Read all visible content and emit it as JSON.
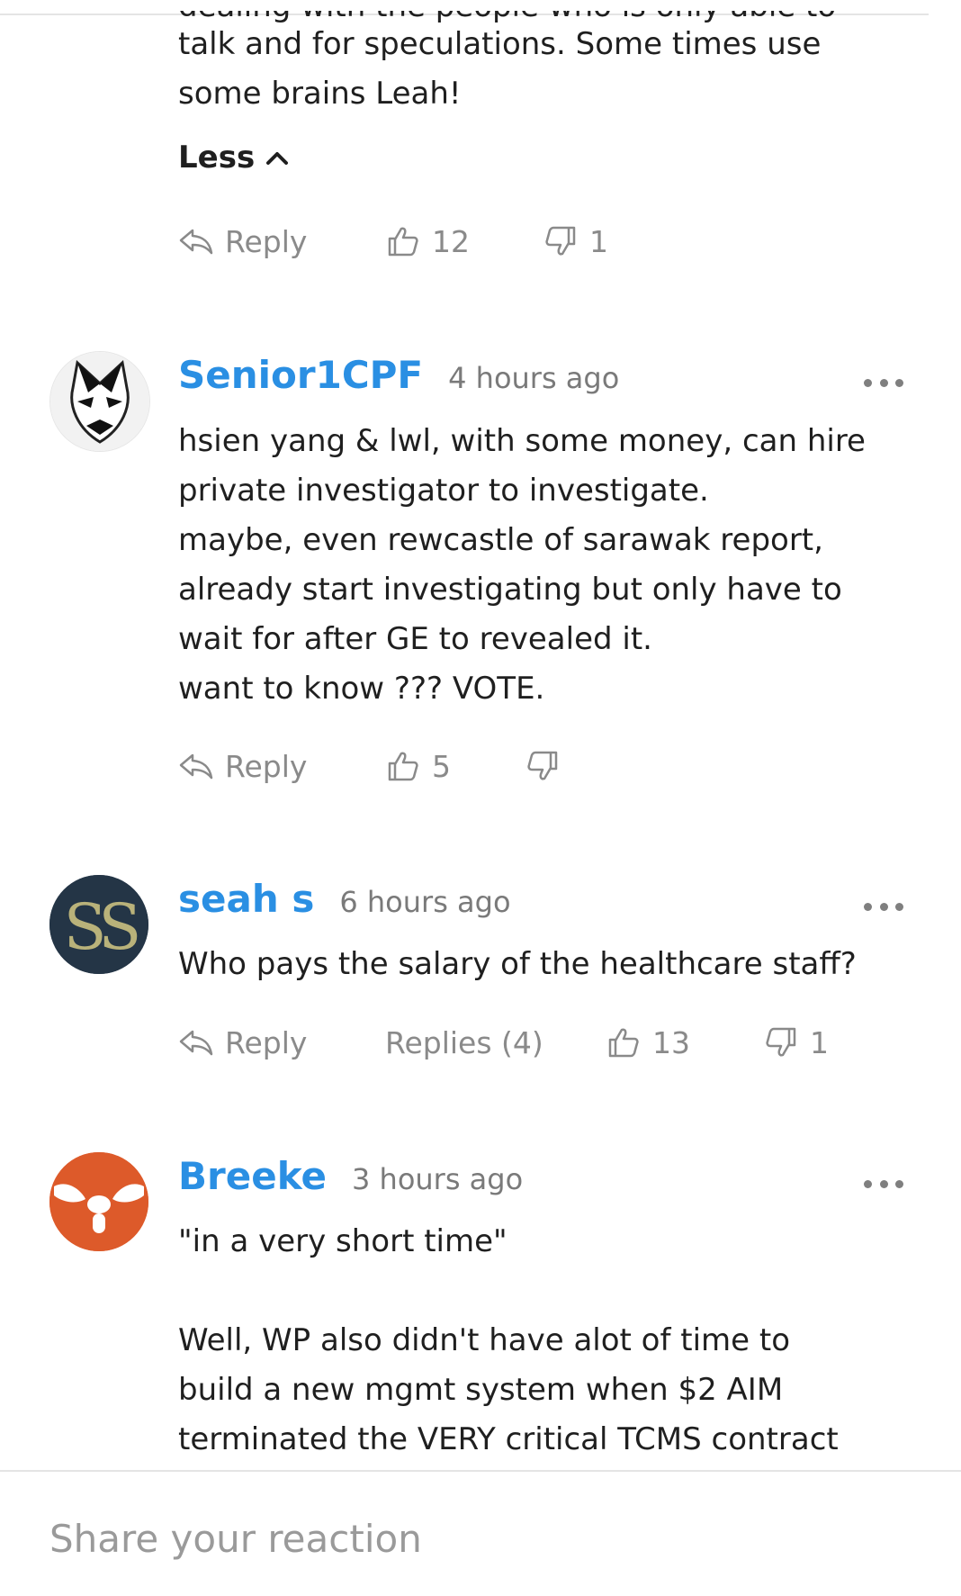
{
  "comments": [
    {
      "partial_top_line": "dealing with the people who is only able to",
      "text_lines": [
        "talk and for speculations. Some times use",
        "some brains Leah!"
      ],
      "less_label": "Less",
      "actions": {
        "reply": "Reply",
        "likes": "12",
        "dislikes": "1"
      }
    },
    {
      "username": "Senior1CPF",
      "time": "4 hours ago",
      "text_lines": [
        "hsien yang & lwl, with some money, can hire",
        "private investigator to investigate.",
        "maybe, even rewcastle of sarawak report,",
        "already start investigating but only have to",
        "wait for after GE to revealed it.",
        "want to know ??? VOTE."
      ],
      "actions": {
        "reply": "Reply",
        "likes": "5",
        "dislikes": ""
      }
    },
    {
      "username": "seah s",
      "time": "6 hours ago",
      "text_lines": [
        "Who pays the salary of the healthcare staff?"
      ],
      "actions": {
        "reply": "Reply",
        "replies": "Replies (4)",
        "likes": "13",
        "dislikes": "1"
      }
    },
    {
      "username": "Breeke",
      "time": "3 hours ago",
      "text_lines": [
        "\"in a very short time\"",
        "",
        "Well, WP also didn't have alot of time to",
        "build a new mgmt system when $2 AIM",
        "terminated the VERY critical TCMS contract"
      ]
    }
  ],
  "reaction_input": {
    "placeholder": "Share your reaction"
  },
  "colors": {
    "username": "#2a8fe3",
    "muted": "#8a8a8a",
    "text": "#1f1f1f",
    "divider": "#e4e4e4"
  },
  "icons": [
    "reply-icon",
    "thumbs-up-icon",
    "thumbs-down-icon",
    "more-icon",
    "chevron-up-icon"
  ]
}
